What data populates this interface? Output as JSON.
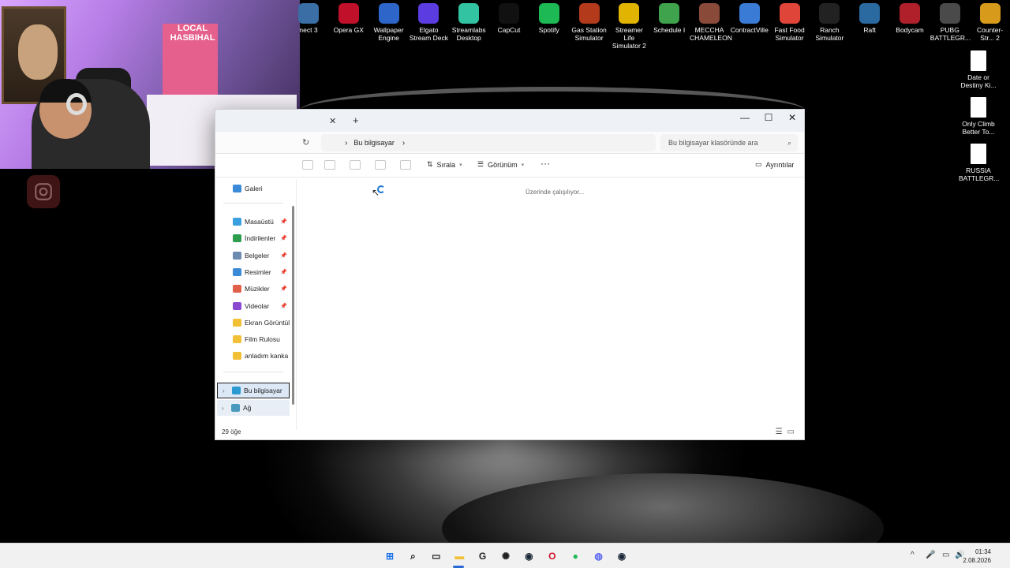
{
  "desktop": {
    "icons": [
      {
        "label": "nect 3",
        "icon": "app-icon",
        "color": "#3a6ea5"
      },
      {
        "label": "Opera GX",
        "icon": "opera-gx-icon",
        "color": "#c0102a"
      },
      {
        "label": "Wallpaper Engine",
        "icon": "wallpaper-engine-icon",
        "color": "#2d66c8"
      },
      {
        "label": "Elgato Stream Deck",
        "icon": "stream-deck-icon",
        "color": "#5b3ce0"
      },
      {
        "label": "Streamlabs Desktop",
        "icon": "streamlabs-icon",
        "color": "#31c3a2"
      },
      {
        "label": "CapCut",
        "icon": "capcut-icon",
        "color": "#111111"
      },
      {
        "label": "Spotify",
        "icon": "spotify-icon",
        "color": "#1db954"
      },
      {
        "label": "Gas Station Simulator",
        "icon": "gas-station-icon",
        "color": "#b33a1a"
      },
      {
        "label": "Streamer Life Simulator 2",
        "icon": "streamer-life-icon",
        "color": "#e0b400"
      },
      {
        "label": "Schedule I",
        "icon": "schedule-icon",
        "color": "#3fa34d"
      },
      {
        "label": "MECCHA CHAMELEON",
        "icon": "meccha-icon",
        "color": "#8a4a3a"
      },
      {
        "label": "ContractVille",
        "icon": "contractville-icon",
        "color": "#3a7bd5"
      },
      {
        "label": "Fast Food Simulator",
        "icon": "fast-food-icon",
        "color": "#e0453a"
      },
      {
        "label": "Ranch Simulator",
        "icon": "ranch-icon",
        "color": "#222222"
      },
      {
        "label": "Raft",
        "icon": "raft-icon",
        "color": "#2a6aa0"
      },
      {
        "label": "Bodycam",
        "icon": "bodycam-icon",
        "color": "#b0202a"
      },
      {
        "label": "PUBG BATTLEGR...",
        "icon": "pubg-icon",
        "color": "#4a4a4a"
      },
      {
        "label": "Counter-Str... 2",
        "icon": "counter-strike-icon",
        "color": "#d89a1a"
      }
    ],
    "right_icons": [
      {
        "label": "Date or Destiny Ki..."
      },
      {
        "label": "Only Climb Better To..."
      },
      {
        "label": "RUSSIA BATTLEGR..."
      }
    ]
  },
  "webcam": {
    "sign_text": "LOCAL HASBIHAL"
  },
  "explorer": {
    "address": "Bu bilgisayar",
    "search_placeholder": "Bu bilgisayar klasöründe ara",
    "toolbar": {
      "sort": "Sırala",
      "view": "Görünüm",
      "more": "···",
      "details": "Ayrıntılar"
    },
    "nav": {
      "gallery": "Galeri",
      "quick": [
        {
          "label": "Masaüstü",
          "pinned": true,
          "color": "#3aa0e0"
        },
        {
          "label": "İndirilenler",
          "pinned": true,
          "color": "#2e9d4e"
        },
        {
          "label": "Belgeler",
          "pinned": true,
          "color": "#6d8ab0"
        },
        {
          "label": "Resimler",
          "pinned": true,
          "color": "#3a8ad8"
        },
        {
          "label": "Müzikler",
          "pinned": true,
          "color": "#e0604a"
        },
        {
          "label": "Videolar",
          "pinned": true,
          "color": "#8a4ad0"
        },
        {
          "label": "Ekran Görüntüleri",
          "pinned": false,
          "color": "#f2c037"
        },
        {
          "label": "Film Rulosu",
          "pinned": false,
          "color": "#f2c037"
        },
        {
          "label": "anladım kanka çok",
          "pinned": false,
          "color": "#f2c037"
        }
      ],
      "this_pc": "Bu bilgisayar",
      "network": "Ağ"
    },
    "content": {
      "status": "Üzerinde çalışılıyor..."
    },
    "statusbar": {
      "count": "29 öğe"
    }
  },
  "taskbar": {
    "apps": [
      {
        "name": "windows-start-icon",
        "glyph": "⊞",
        "color": "#1a73e8"
      },
      {
        "name": "search-icon",
        "glyph": "⌕",
        "color": "#222222"
      },
      {
        "name": "task-view-icon",
        "glyph": "▭",
        "color": "#222222"
      },
      {
        "name": "file-explorer-icon",
        "glyph": "▬",
        "color": "#f2c037"
      },
      {
        "name": "app-g-icon",
        "glyph": "G",
        "color": "#222222"
      },
      {
        "name": "app-chatgpt-icon",
        "glyph": "✺",
        "color": "#222222"
      },
      {
        "name": "steam-icon",
        "glyph": "◉",
        "color": "#1b2838"
      },
      {
        "name": "opera-icon",
        "glyph": "O",
        "color": "#d0102a"
      },
      {
        "name": "spotify-icon",
        "glyph": "●",
        "color": "#1db954"
      },
      {
        "name": "discord-icon",
        "glyph": "◍",
        "color": "#5865f2"
      },
      {
        "name": "steam-icon-2",
        "glyph": "◉",
        "color": "#1b2838"
      }
    ],
    "tray": {
      "chevron": "^",
      "mic": "🎤",
      "network": "▭",
      "volume": "🔊"
    },
    "time": "01:34",
    "date": "2.08.2026"
  }
}
